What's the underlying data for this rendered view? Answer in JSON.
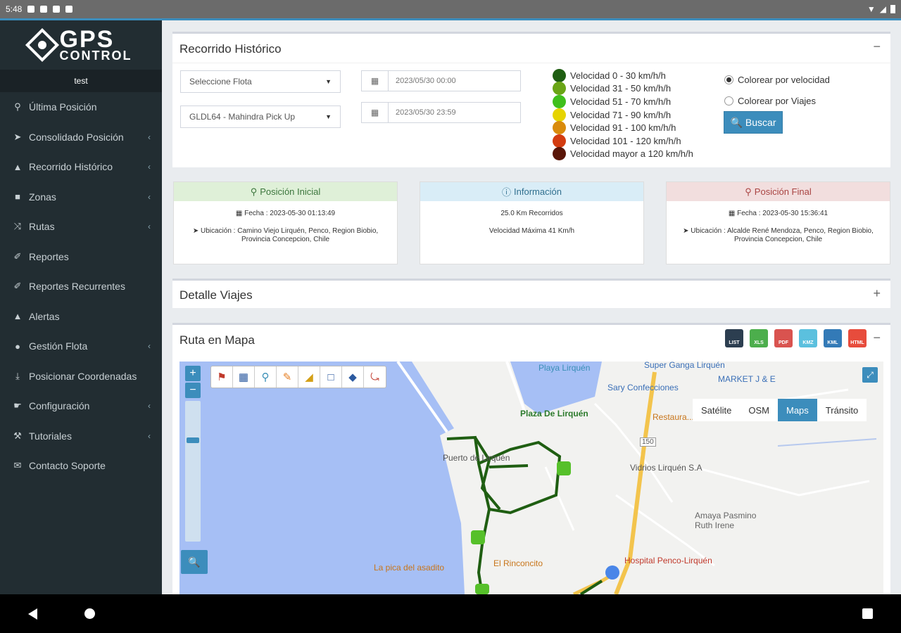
{
  "statusbar": {
    "time": "5:48"
  },
  "sidebar": {
    "logo_big": "GPS",
    "logo_small": "CONTROL",
    "user": "test",
    "items": [
      {
        "icon": "map-marker-icon",
        "glyph": "⚲",
        "label": "Última Posición",
        "chevron": ""
      },
      {
        "icon": "location-arrow-icon",
        "glyph": "➤",
        "label": "Consolidado Posición",
        "chevron": "‹"
      },
      {
        "icon": "road-icon",
        "glyph": "▲",
        "label": "Recorrido Histórico",
        "chevron": "‹"
      },
      {
        "icon": "map-icon",
        "glyph": "■",
        "label": "Zonas",
        "chevron": "‹"
      },
      {
        "icon": "random-icon",
        "glyph": "⤨",
        "label": "Rutas",
        "chevron": "‹"
      },
      {
        "icon": "paperclip-icon",
        "glyph": "✐",
        "label": "Reportes",
        "chevron": ""
      },
      {
        "icon": "paperclip-icon",
        "glyph": "✐",
        "label": "Reportes Recurrentes",
        "chevron": ""
      },
      {
        "icon": "warning-icon",
        "glyph": "▲",
        "label": "Alertas",
        "chevron": ""
      },
      {
        "icon": "globe-icon",
        "glyph": "●",
        "label": "Gestión Flota",
        "chevron": "‹"
      },
      {
        "icon": "download-icon",
        "glyph": "⤓",
        "label": "Posicionar Coordenadas",
        "chevron": ""
      },
      {
        "icon": "hand-pointer-icon",
        "glyph": "☛",
        "label": "Configuración",
        "chevron": "‹"
      },
      {
        "icon": "wrench-icon",
        "glyph": "⚒",
        "label": "Tutoriales",
        "chevron": "‹"
      },
      {
        "icon": "envelope-icon",
        "glyph": "✉",
        "label": "Contacto Soporte",
        "chevron": ""
      }
    ]
  },
  "recorrido": {
    "title": "Recorrido Histórico",
    "collapse": "−",
    "fleet_select": "Seleccione Flota",
    "vehicle_select": "GLDL64 - Mahindra Pick Up",
    "date_from": "2023/05/30 00:00",
    "date_to": "2023/05/30 23:59",
    "legend": [
      {
        "label": "Velocidad 0 - 30 km/h/h",
        "color": "#1f5e12"
      },
      {
        "label": "Velocidad 31 - 50 km/h/h",
        "color": "#6aa516"
      },
      {
        "label": "Velocidad 51 - 70 km/h/h",
        "color": "#3fbf1c"
      },
      {
        "label": "Velocidad 71 - 90 km/h/h",
        "color": "#e6d400"
      },
      {
        "label": "Velocidad 91 - 100 km/h/h",
        "color": "#d98b0c"
      },
      {
        "label": "Velocidad 101 - 120 km/h/h",
        "color": "#d33c10"
      },
      {
        "label": "Velocidad mayor a 120 km/h/h",
        "color": "#5a1608"
      }
    ],
    "radio_speed": "Colorear por velocidad",
    "radio_trips": "Colorear por Viajes",
    "search_button": "Buscar"
  },
  "cards": {
    "inicial": {
      "title": "Posición Inicial",
      "fecha": "Fecha : 2023-05-30 01:13:49",
      "ubicacion": "Ubicación : Camino Viejo Lirquén, Penco, Region Biobio, Provincia Concepcion, Chile",
      "bg": "#dff0d8",
      "fg": "#3c763d"
    },
    "info": {
      "title": "Información",
      "km": "25.0 Km Recorridos",
      "vel": "Velocidad Máxima 41 Km/h",
      "bg": "#d9edf7",
      "fg": "#31708f"
    },
    "final": {
      "title": "Posición Final",
      "fecha": "Fecha : 2023-05-30 15:36:41",
      "ubicacion": "Ubicación : Alcalde René Mendoza, Penco, Region Biobio, Provincia Concepcion, Chile",
      "bg": "#f2dede",
      "fg": "#a94442"
    }
  },
  "detalle": {
    "title": "Detalle Viajes",
    "expand": "+"
  },
  "ruta": {
    "title": "Ruta en Mapa",
    "collapse": "−",
    "exports": [
      {
        "label": "LIST",
        "color": "#2c3e50"
      },
      {
        "label": "XLS",
        "color": "#4cae4c"
      },
      {
        "label": "PDF",
        "color": "#d9534f"
      },
      {
        "label": "KMZ",
        "color": "#5bc0de"
      },
      {
        "label": "KML",
        "color": "#337ab7"
      },
      {
        "label": "HTML",
        "color": "#e74c3c"
      }
    ],
    "map_types": [
      "Satélite",
      "OSM",
      "Maps",
      "Tránsito"
    ],
    "map_active": "Maps",
    "map_labels": {
      "playa": "Playa Lirquén",
      "super": "Super Ganga Lirquén",
      "market": "MARKET J & E",
      "sary": "Sary Confecciones",
      "plaza": "Plaza De Lirquén",
      "restaurante": "Restaura...",
      "puerto": "Puerto de Lirquén",
      "vidrios": "Vidrios Lirquén S.A",
      "amaya": "Amaya Pasmino Ruth Irene",
      "hospital": "Hospital Penco-Lirquén",
      "pica": "La pica del asadito",
      "rinconcito": "El Rinconcito",
      "ruta": "150"
    }
  }
}
